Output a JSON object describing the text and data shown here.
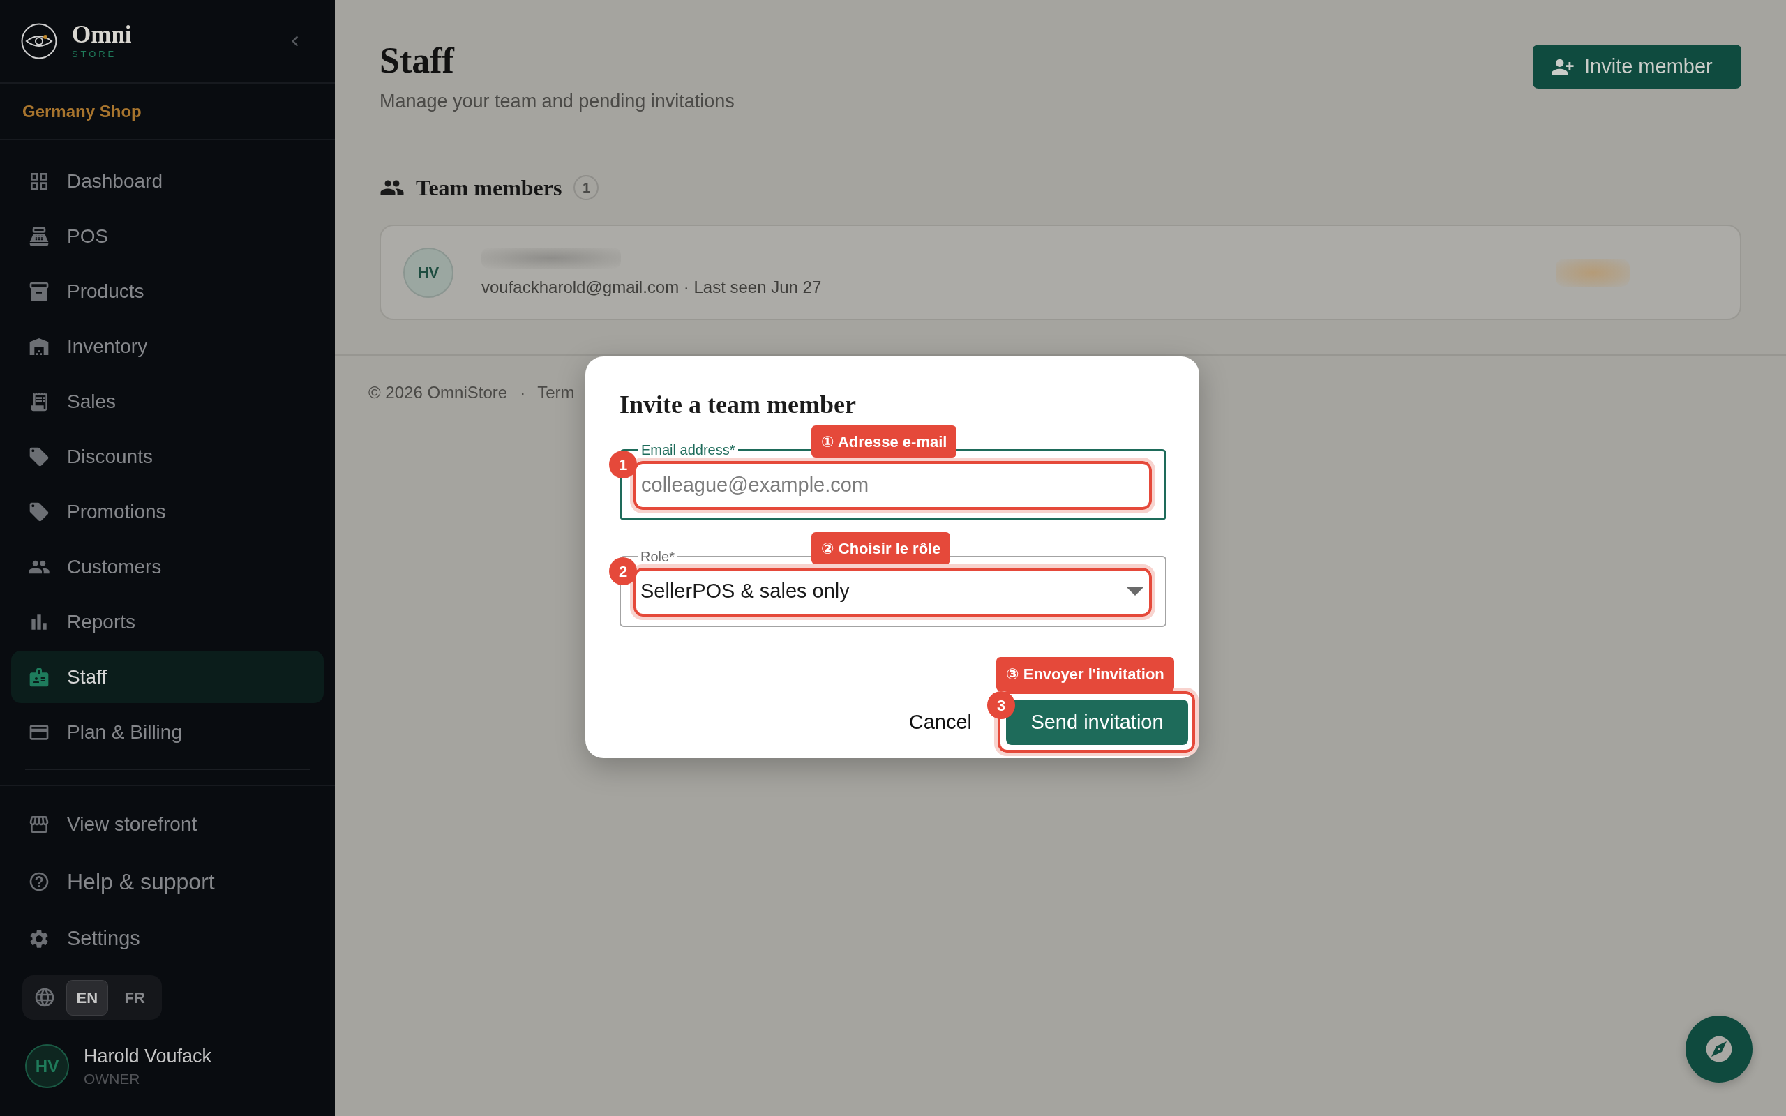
{
  "sidebar": {
    "brand": {
      "name": "Omni",
      "tagline": "STORE"
    },
    "shop_name": "Germany Shop",
    "nav_items": [
      {
        "label": "Dashboard",
        "selected": false
      },
      {
        "label": "POS",
        "selected": false
      },
      {
        "label": "Products",
        "selected": false
      },
      {
        "label": "Inventory",
        "selected": false
      },
      {
        "label": "Sales",
        "selected": false
      },
      {
        "label": "Discounts",
        "selected": false
      },
      {
        "label": "Promotions",
        "selected": false
      },
      {
        "label": "Customers",
        "selected": false
      },
      {
        "label": "Reports",
        "selected": false
      },
      {
        "label": "Staff",
        "selected": true
      },
      {
        "label": "Plan & Billing",
        "selected": false
      }
    ],
    "bottom_links": [
      {
        "label": "View storefront"
      },
      {
        "label": "Help & support"
      },
      {
        "label": "Settings"
      }
    ],
    "languages": [
      {
        "label": "EN",
        "selected": true
      },
      {
        "label": "FR",
        "selected": false
      }
    ],
    "user": {
      "initials": "HV",
      "name": "Harold Voufack",
      "role": "OWNER"
    }
  },
  "header": {
    "title": "Staff",
    "subtitle": "Manage your team and pending invitations",
    "invite_button": "Invite member"
  },
  "team_members": {
    "title": "Team members",
    "count": "1",
    "members": [
      {
        "initials": "HV",
        "details": "voufackharold@gmail.com · Last seen Jun 27"
      }
    ]
  },
  "footer": {
    "copyright": "© 2026 OmniStore",
    "separator": "·",
    "link": "Term"
  },
  "dialog": {
    "title": "Invite a team member",
    "fields": [
      {
        "kind": "text",
        "label": "Email address*",
        "placeholder": "colleague@example.com",
        "focused": true,
        "annotation": {
          "number": "1",
          "label": "① Adresse e-mail"
        }
      },
      {
        "kind": "select",
        "label": "Role*",
        "value": "SellerPOS & sales only",
        "focused": false,
        "annotation": {
          "number": "2",
          "label": "② Choisir le rôle"
        }
      }
    ],
    "actions": [
      {
        "kind": "text",
        "label": "Cancel"
      },
      {
        "kind": "primary",
        "label": "Send invitation",
        "annotation": {
          "number": "3",
          "label": "③ Envoyer l'invitation"
        }
      }
    ]
  }
}
